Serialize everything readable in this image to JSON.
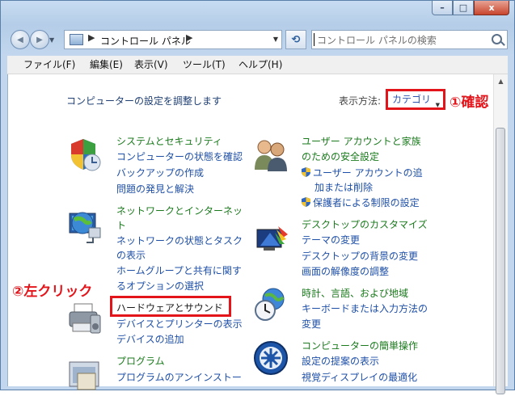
{
  "window": {
    "minimize_glyph": "–",
    "maximize_glyph": "□",
    "close_glyph": "x"
  },
  "navbar": {
    "back_glyph": "◀",
    "forward_glyph": "▶",
    "address_path": "コントロール パネル",
    "refresh_glyph": "⟲",
    "search_placeholder": "コントロール パネルの検索"
  },
  "menubar": [
    "ファイル(F)",
    "編集(E)",
    "表示(V)",
    "ツール(T)",
    "ヘルプ(H)"
  ],
  "header": {
    "title": "コンピューターの設定を調整します",
    "view_by_label": "表示方法:",
    "view_by_value": "カテゴリ"
  },
  "annotations": {
    "confirm": "①確認",
    "left_click": "②左クリック"
  },
  "categories_left": [
    {
      "icon": "shield-security-icon",
      "title": "システムとセキュリティ",
      "links": [
        "コンピューターの状態を確認",
        "バックアップの作成",
        "問題の発見と解決"
      ]
    },
    {
      "icon": "network-globe-icon",
      "title_lines": [
        "ネットワークとインターネッ",
        "ト"
      ],
      "links": [
        "ネットワークの状態とタスク",
        "の表示",
        "ホームグループと共有に関す",
        "るオプションの選択"
      ]
    },
    {
      "icon": "printer-sound-icon",
      "title": "ハードウェアとサウンド",
      "links": [
        "デバイスとプリンターの表示",
        "デバイスの追加"
      ]
    },
    {
      "icon": "programs-icon",
      "title": "プログラム",
      "links": [
        "プログラムのアンインストー"
      ]
    }
  ],
  "categories_right": [
    {
      "icon": "user-accounts-icon",
      "title_lines": [
        "ユーザー アカウントと家族",
        "のための安全設定"
      ],
      "links": [
        "ユーザー アカウントの追",
        "加または削除",
        "保護者による制限の設定"
      ]
    },
    {
      "icon": "desktop-appearance-icon",
      "title": "デスクトップのカスタマイズ",
      "links": [
        "テーマの変更",
        "デスクトップの背景の変更",
        "画面の解像度の調整"
      ]
    },
    {
      "icon": "clock-globe-icon",
      "title": "時計、言語、および地域",
      "links": [
        "キーボードまたは入力方法の",
        "変更"
      ]
    },
    {
      "icon": "ease-of-access-icon",
      "title": "コンピューターの簡単操作",
      "links": [
        "設定の提案の表示",
        "視覚ディスプレイの最適化"
      ]
    }
  ],
  "colors": {
    "highlight": "#e3151b",
    "link_green": "#1a7a1c",
    "link_blue": "#1e4fa6"
  }
}
